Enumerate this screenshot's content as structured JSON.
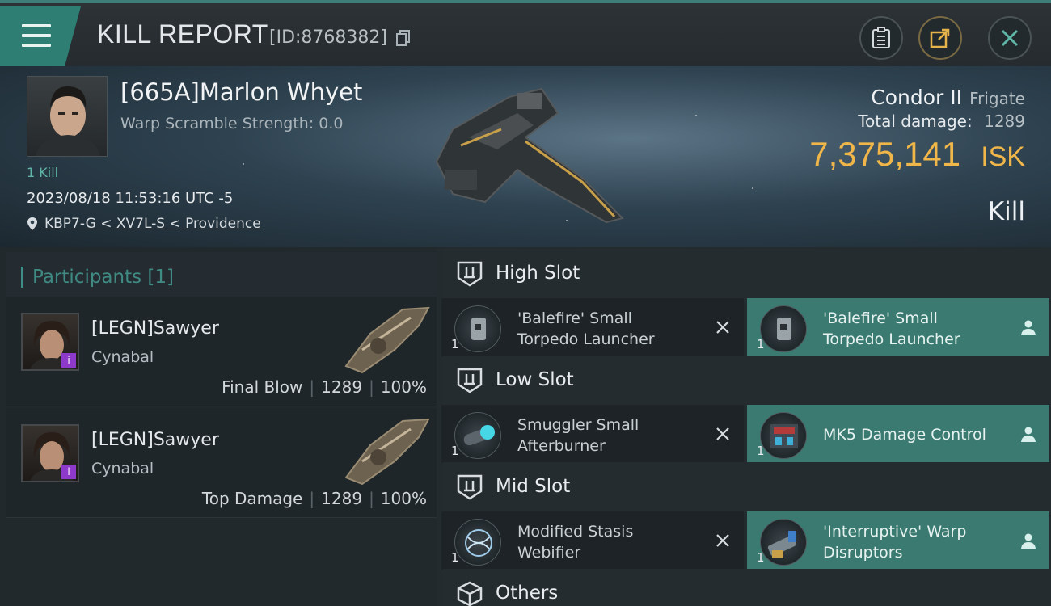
{
  "header": {
    "title": "KILL REPORT",
    "report_id": "[ID:8768382]"
  },
  "victim": {
    "name": "[665A]Marlon Whyet",
    "warp_scramble": "Warp Scramble Strength: 0.0",
    "kill_count": "1 Kill",
    "timestamp": "2023/08/18 11:53:16 UTC -5",
    "location": "KBP7-G < XV7L-S < Providence"
  },
  "ship": {
    "name": "Condor II",
    "class": "Frigate",
    "total_damage_label": "Total damage:",
    "total_damage": "1289",
    "isk_value": "7,375,141",
    "isk_unit": "ISK",
    "result": "Kill"
  },
  "participants": {
    "header": "Participants [1]",
    "rows": [
      {
        "name": "[LEGN]Sawyer",
        "ship": "Cynabal",
        "role": "Final Blow",
        "damage": "1289",
        "percent": "100%"
      },
      {
        "name": "[LEGN]Sawyer",
        "ship": "Cynabal",
        "role": "Top Damage",
        "damage": "1289",
        "percent": "100%"
      }
    ]
  },
  "slots": {
    "high": {
      "label": "High Slot",
      "modules": [
        {
          "name_line1": "'Balefire' Small",
          "name_line2": "Torpedo Launcher",
          "qty": "1",
          "status": "dropped"
        },
        {
          "name_line1": "'Balefire' Small",
          "name_line2": "Torpedo Launcher",
          "qty": "1",
          "status": "destroyed"
        }
      ]
    },
    "low": {
      "label": "Low Slot",
      "modules": [
        {
          "name_line1": "Smuggler Small",
          "name_line2": "Afterburner",
          "qty": "1",
          "status": "dropped"
        },
        {
          "name_line1": "MK5 Damage Control",
          "name_line2": "",
          "qty": "1",
          "status": "destroyed"
        }
      ]
    },
    "mid": {
      "label": "Mid Slot",
      "modules": [
        {
          "name_line1": "Modified Stasis",
          "name_line2": "Webifier",
          "qty": "1",
          "status": "dropped"
        },
        {
          "name_line1": "'Interruptive' Warp",
          "name_line2": "Disruptors",
          "qty": "1",
          "status": "destroyed"
        }
      ]
    },
    "others": {
      "label": "Others"
    }
  },
  "colors": {
    "accent_teal": "#3d8f85",
    "isk_gold": "#f0b64a",
    "badge_purple": "#8d39c9"
  }
}
